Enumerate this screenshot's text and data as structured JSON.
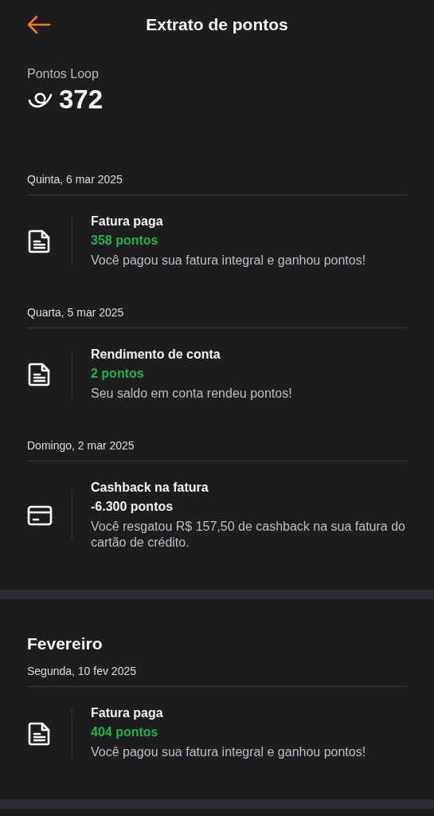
{
  "header": {
    "title": "Extrato de pontos"
  },
  "balance": {
    "label": "Pontos Loop",
    "value": "372"
  },
  "months": [
    {
      "days": [
        {
          "date": "Quinta, 6 mar 2025",
          "entries": [
            {
              "kind": "document",
              "title": "Fatura paga",
              "points": "358 pontos",
              "positive": true,
              "description": "Você pagou sua fatura integral e ganhou pontos!"
            }
          ]
        },
        {
          "date": "Quarta, 5 mar 2025",
          "entries": [
            {
              "kind": "document",
              "title": "Rendimento de conta",
              "points": "2 pontos",
              "positive": true,
              "description": "Seu saldo em conta rendeu pontos!"
            }
          ]
        },
        {
          "date": "Domingo, 2 mar 2025",
          "entries": [
            {
              "kind": "card",
              "title": "Cashback na fatura",
              "points": "-6.300 pontos",
              "positive": false,
              "description": "Você resgatou R$ 157,50 de cashback na sua fatura do cartão de crédito."
            }
          ]
        }
      ]
    },
    {
      "title": "Fevereiro",
      "days": [
        {
          "date": "Segunda, 10 fev 2025",
          "entries": [
            {
              "kind": "document",
              "title": "Fatura paga",
              "points": "404 pontos",
              "positive": true,
              "description": "Você pagou sua fatura integral e ganhou pontos!"
            }
          ]
        }
      ]
    }
  ]
}
